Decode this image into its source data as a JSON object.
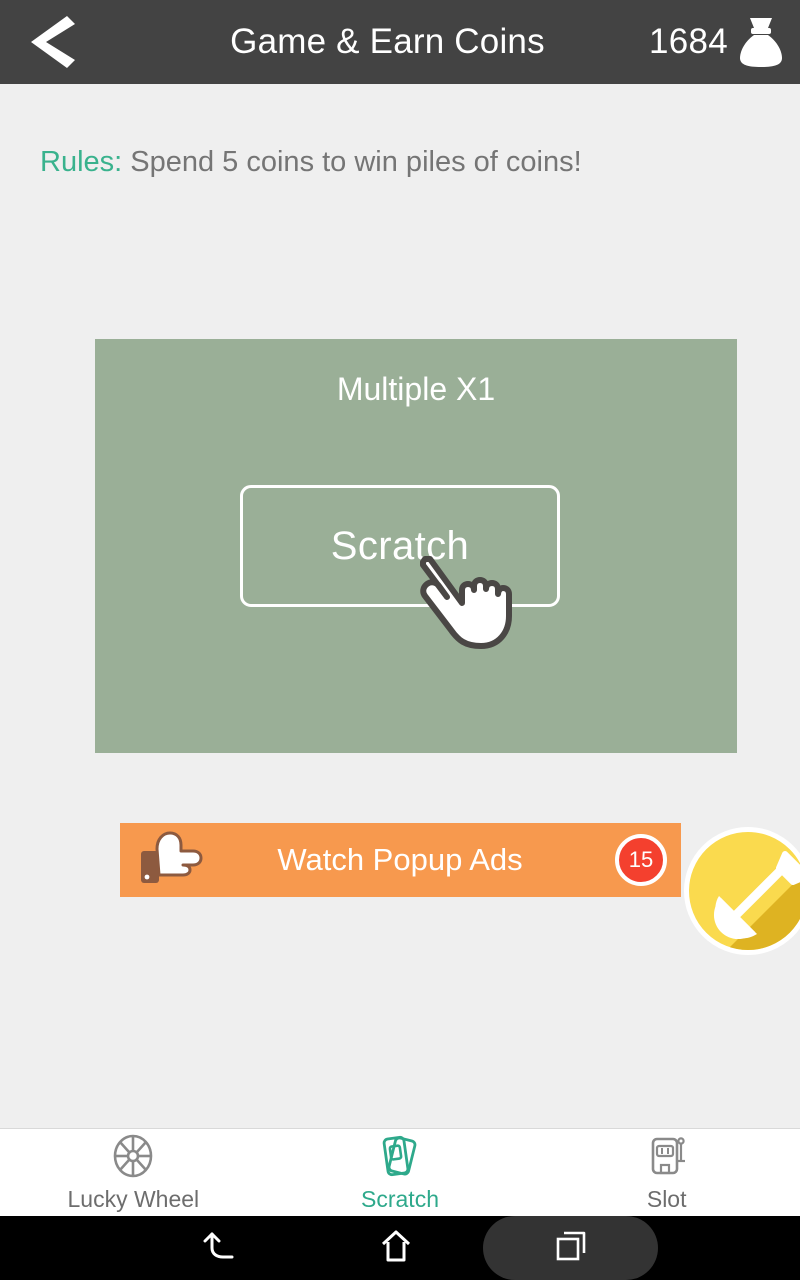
{
  "header": {
    "back_icon": "chevron-left-icon",
    "title": "Game & Earn Coins",
    "coin_count": "1684",
    "coin_icon": "money-bag-icon",
    "bg_color": "#434343"
  },
  "rules": {
    "label": "Rules:",
    "text": "Spend 5 coins to win piles of coins!",
    "label_color": "#39b28d",
    "text_color": "#757575"
  },
  "scratch_card": {
    "multiple_label": "Multiple X1",
    "button_label": "Scratch",
    "panel_color": "#9aaf97",
    "cursor_icon": "pointing-hand-cursor-icon"
  },
  "ads_banner": {
    "icon": "hand-pointing-right-icon",
    "label": "Watch Popup Ads",
    "badge_count": "15",
    "bg_color": "#f7994e",
    "badge_color": "#f4402e"
  },
  "fab": {
    "icon": "shovel-icon",
    "bg_color": "#fada4e"
  },
  "tabs": [
    {
      "label": "Lucky Wheel",
      "icon": "lucky-wheel-icon",
      "active": false
    },
    {
      "label": "Scratch",
      "icon": "scratch-cards-icon",
      "active": true
    },
    {
      "label": "Slot",
      "icon": "slot-machine-icon",
      "active": false
    }
  ],
  "android_nav": {
    "back": "back-arrow-icon",
    "home": "home-icon",
    "recents": "recents-icon"
  }
}
